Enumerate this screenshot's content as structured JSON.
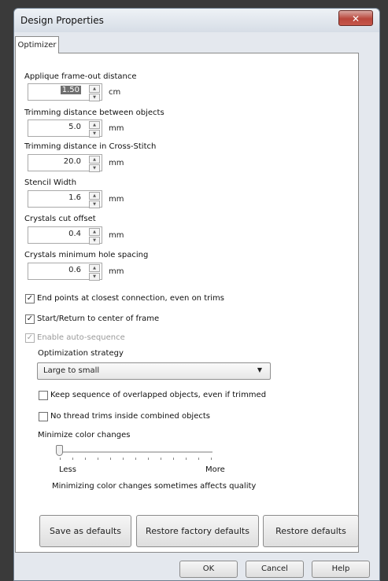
{
  "window": {
    "title": "Design Properties",
    "close_label": "✕"
  },
  "tab": {
    "label": "Optimizer"
  },
  "fields": [
    {
      "label": "Applique frame-out distance",
      "value": "1.50",
      "unit": "cm",
      "selected": true
    },
    {
      "label": "Trimming distance between objects",
      "value": "5.0",
      "unit": "mm"
    },
    {
      "label": "Trimming distance in Cross-Stitch",
      "value": "20.0",
      "unit": "mm"
    },
    {
      "label": "Stencil Width",
      "value": "1.6",
      "unit": "mm"
    },
    {
      "label": "Crystals cut offset",
      "value": "0.4",
      "unit": "mm"
    },
    {
      "label": "Crystals minimum hole spacing",
      "value": "0.6",
      "unit": "mm"
    }
  ],
  "checks": {
    "end_points": {
      "label": "End points at closest connection, even on trims",
      "checked": true
    },
    "start_return": {
      "label": "Start/Return to center of frame",
      "checked": true
    },
    "auto_sequence": {
      "label": "Enable auto-sequence",
      "checked": true,
      "disabled": true
    },
    "keep_sequence": {
      "label": "Keep sequence of overlapped objects, even if trimmed",
      "checked": false
    },
    "no_trims": {
      "label": "No thread trims inside combined objects",
      "checked": false
    }
  },
  "optimization": {
    "label": "Optimization strategy",
    "selected": "Large to small"
  },
  "color_changes": {
    "label": "Minimize color changes",
    "less": "Less",
    "more": "More",
    "level": 0,
    "note": "Minimizing color changes sometimes affects quality"
  },
  "buttons": {
    "save_defaults": "Save as defaults",
    "restore_factory": "Restore factory defaults",
    "restore_defaults": "Restore defaults",
    "ok": "OK",
    "cancel": "Cancel",
    "help": "Help"
  }
}
